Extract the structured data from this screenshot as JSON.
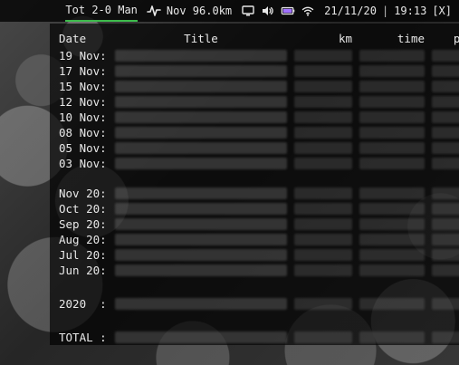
{
  "topbar": {
    "activity_label": "Tot 2-0 Man",
    "nov_distance_label": "Nov 96.0km",
    "date": "21/11/20",
    "time": "19:13",
    "suffix": "[X]",
    "separator": "|"
  },
  "table": {
    "headers": {
      "date": "Date",
      "title": "Title",
      "km": "km",
      "time": "time",
      "pace": "pace"
    },
    "recent_rows": [
      {
        "date": "19 Nov:"
      },
      {
        "date": "17 Nov:"
      },
      {
        "date": "15 Nov:"
      },
      {
        "date": "12 Nov:"
      },
      {
        "date": "10 Nov:"
      },
      {
        "date": "08 Nov:"
      },
      {
        "date": "05 Nov:"
      },
      {
        "date": "03 Nov:"
      }
    ],
    "monthly_rows": [
      {
        "date": "Nov 20:"
      },
      {
        "date": "Oct 20:"
      },
      {
        "date": "Sep 20:"
      },
      {
        "date": "Aug 20:"
      },
      {
        "date": "Jul 20:"
      },
      {
        "date": "Jun 20:"
      }
    ],
    "summary_rows": {
      "year": {
        "date": "2020  :"
      },
      "total": {
        "date": "TOTAL :"
      }
    }
  },
  "icons": {
    "activity": "heartbeat-icon",
    "monitor": "monitor-icon",
    "volume": "volume-icon",
    "battery": "battery-icon",
    "wifi": "wifi-icon"
  },
  "colors": {
    "accent_green": "#3dbb4c",
    "battery_purple": "#a070ff"
  }
}
